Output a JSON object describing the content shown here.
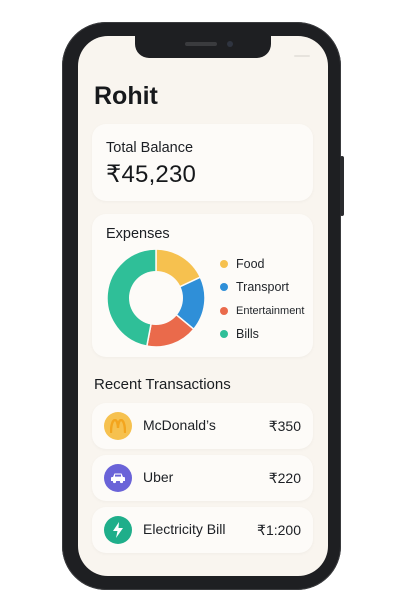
{
  "profile": {
    "name": "Rohit"
  },
  "balance": {
    "label": "Total Balance",
    "value": "₹45,230"
  },
  "expenses": {
    "title": "Expenses",
    "categories": [
      {
        "label": "Food",
        "color": "#f6c14f",
        "share": 0.18
      },
      {
        "label": "Transport",
        "color": "#2f8fd8",
        "share": 0.18
      },
      {
        "label": "Entertainment",
        "color": "#ea6a4b",
        "share": 0.17
      },
      {
        "label": "Bills",
        "color": "#2fbf98",
        "share": 0.47
      }
    ]
  },
  "transactions": {
    "title": "Recent Transactions",
    "items": [
      {
        "name": "McDonald’s",
        "amount": "₹350",
        "icon": "mcdonalds-logo-icon",
        "icon_color": "#f6c14f"
      },
      {
        "name": "Uber",
        "amount": "₹220",
        "icon": "car-icon",
        "icon_color": "#6a63d8"
      },
      {
        "name": "Electricity Bill",
        "amount": "₹1:200",
        "icon": "lightning-icon",
        "icon_color": "#1fae8a"
      }
    ]
  }
}
